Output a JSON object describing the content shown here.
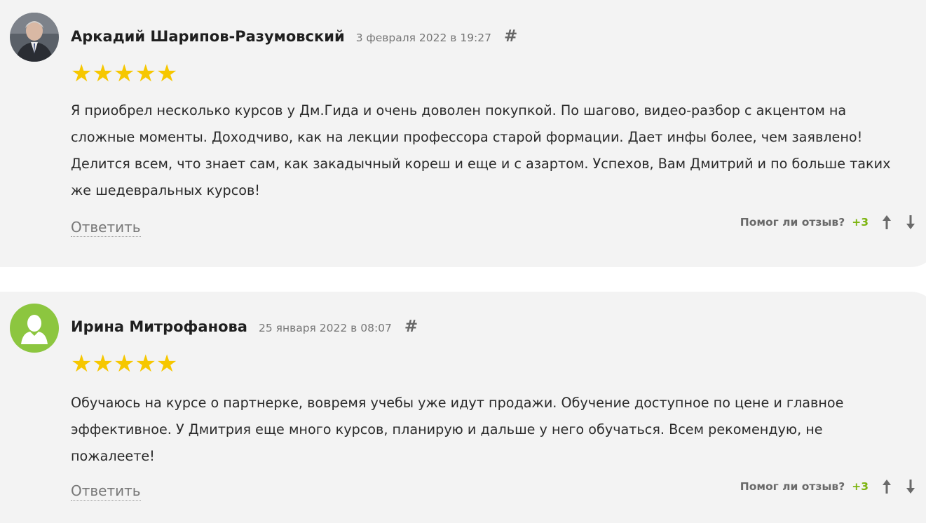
{
  "reviews": [
    {
      "author": "Аркадий Шарипов-Разумовский",
      "date": "3 февраля 2022 в 19:27",
      "hash": "#",
      "stars": "★★★★★",
      "text": "Я приобрел несколько курсов у Дм.Гида и очень доволен покупкой. По шагово, видео-разбор с акцентом на сложные моменты. Доходчиво, как на лекции профессора старой формации. Дает инфы более, чем заявлено! Делится всем, что знает сам, как закадычный кореш и еще и с азартом. Успехов, Вам Дмитрий и по больше таких же шедевральных курсов!",
      "reply_label": "Ответить",
      "helpful_label": "Помог ли отзыв?",
      "score": "+3",
      "avatar_type": "photo"
    },
    {
      "author": "Ирина Митрофанова",
      "date": "25 января 2022 в 08:07",
      "hash": "#",
      "stars": "★★★★★",
      "text": "Обучаюсь на курсе о партнерке, вовремя учебы уже идут продажи. Обучение доступное по цене и главное эффективное. У Дмитрия еще много курсов, планирую и дальше у него обучаться. Всем рекомендую, не пожалеете!",
      "reply_label": "Ответить",
      "helpful_label": "Помог ли отзыв?",
      "score": "+3",
      "avatar_type": "default-user-icon"
    }
  ],
  "rating": {
    "value": 5,
    "max": 5
  },
  "colors": {
    "card_bg": "#f3f3f3",
    "star": "#f6c700",
    "score": "#7cb40f",
    "default_avatar": "#8cc63f"
  },
  "icons": {
    "vote_up": "arrow-up-icon",
    "vote_down": "arrow-down-icon",
    "default_avatar": "user-silhouette-icon"
  }
}
